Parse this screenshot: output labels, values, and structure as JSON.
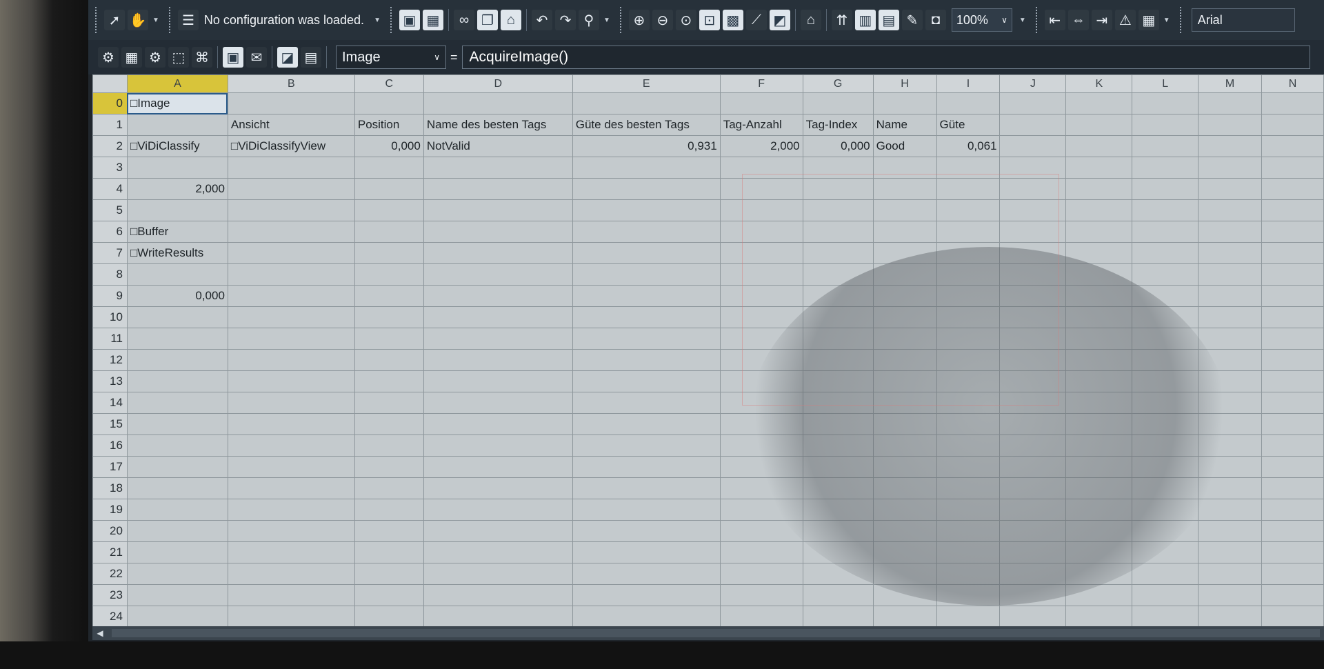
{
  "toolbar_top": {
    "status_message": "No configuration was loaded.",
    "zoom_value": "100%",
    "font_name": "Arial",
    "icons": [
      "pointer-icon",
      "hand-icon",
      "list-icon",
      "image-icon",
      "image-edit-icon",
      "binoculars-icon",
      "copy-icon",
      "paste-icon",
      "undo-icon",
      "redo-icon",
      "find-icon",
      "zoom-in-icon",
      "zoom-out-icon",
      "zoom-fit-icon",
      "zoom-select-icon",
      "grid-icon",
      "chart-icon",
      "image-view-icon",
      "house-icon",
      "insert-row-icon",
      "insert-column-icon",
      "table-icon",
      "pen-icon",
      "camera-icon",
      "align-left-icon",
      "align-center-icon",
      "align-right-icon",
      "warning-icon",
      "format-icon"
    ]
  },
  "toolbar_formula": {
    "name_box": "Image",
    "equals": "=",
    "formula": "AcquireImage()",
    "icons": [
      "toolbox-icon",
      "table-insert-icon",
      "gears-icon",
      "select-icon",
      "network-icon",
      "display-icon",
      "comment-icon",
      "image-window-icon",
      "results-icon"
    ]
  },
  "grid": {
    "columns": [
      "A",
      "B",
      "C",
      "D",
      "E",
      "F",
      "G",
      "H",
      "I",
      "J",
      "K",
      "L",
      "M",
      "N"
    ],
    "selected_column": "A",
    "rows": [
      {
        "num": "0",
        "cells": [
          "□Image",
          "",
          "",
          "",
          "",
          "",
          "",
          "",
          "",
          "",
          "",
          "",
          "",
          ""
        ]
      },
      {
        "num": "1",
        "cells": [
          "",
          "Ansicht",
          "Position",
          "Name des besten Tags",
          "Güte des besten Tags",
          "Tag-Anzahl",
          "Tag-Index",
          "Name",
          "Güte",
          "",
          "",
          "",
          "",
          ""
        ]
      },
      {
        "num": "2",
        "cells": [
          "□ViDiClassify",
          "□ViDiClassifyView",
          "0,000",
          "NotValid",
          "0,931",
          "2,000",
          "0,000",
          "Good",
          "0,061",
          "",
          "",
          "",
          "",
          ""
        ]
      },
      {
        "num": "3",
        "cells": [
          "",
          "",
          "",
          "",
          "",
          "",
          "",
          "",
          "",
          "",
          "",
          "",
          "",
          ""
        ]
      },
      {
        "num": "4",
        "cells": [
          "2,000",
          "",
          "",
          "",
          "",
          "",
          "",
          "",
          "",
          "",
          "",
          "",
          "",
          ""
        ]
      },
      {
        "num": "5",
        "cells": [
          "",
          "",
          "",
          "",
          "",
          "",
          "",
          "",
          "",
          "",
          "",
          "",
          "",
          ""
        ]
      },
      {
        "num": "6",
        "cells": [
          "□Buffer",
          "",
          "",
          "",
          "",
          "",
          "",
          "",
          "",
          "",
          "",
          "",
          "",
          ""
        ]
      },
      {
        "num": "7",
        "cells": [
          "□WriteResults",
          "",
          "",
          "",
          "",
          "",
          "",
          "",
          "",
          "",
          "",
          "",
          "",
          ""
        ]
      },
      {
        "num": "8",
        "cells": [
          "",
          "",
          "",
          "",
          "",
          "",
          "",
          "",
          "",
          "",
          "",
          "",
          "",
          ""
        ]
      },
      {
        "num": "9",
        "cells": [
          "0,000",
          "",
          "",
          "",
          "",
          "",
          "",
          "",
          "",
          "",
          "",
          "",
          "",
          ""
        ]
      },
      {
        "num": "10",
        "cells": [
          "",
          "",
          "",
          "",
          "",
          "",
          "",
          "",
          "",
          "",
          "",
          "",
          "",
          ""
        ]
      },
      {
        "num": "11",
        "cells": [
          "",
          "",
          "",
          "",
          "",
          "",
          "",
          "",
          "",
          "",
          "",
          "",
          "",
          ""
        ]
      },
      {
        "num": "12",
        "cells": [
          "",
          "",
          "",
          "",
          "",
          "",
          "",
          "",
          "",
          "",
          "",
          "",
          "",
          ""
        ]
      },
      {
        "num": "13",
        "cells": [
          "",
          "",
          "",
          "",
          "",
          "",
          "",
          "",
          "",
          "",
          "",
          "",
          "",
          ""
        ]
      },
      {
        "num": "14",
        "cells": [
          "",
          "",
          "",
          "",
          "",
          "",
          "",
          "",
          "",
          "",
          "",
          "",
          "",
          ""
        ]
      },
      {
        "num": "15",
        "cells": [
          "",
          "",
          "",
          "",
          "",
          "",
          "",
          "",
          "",
          "",
          "",
          "",
          "",
          ""
        ]
      },
      {
        "num": "16",
        "cells": [
          "",
          "",
          "",
          "",
          "",
          "",
          "",
          "",
          "",
          "",
          "",
          "",
          "",
          ""
        ]
      },
      {
        "num": "17",
        "cells": [
          "",
          "",
          "",
          "",
          "",
          "",
          "",
          "",
          "",
          "",
          "",
          "",
          "",
          ""
        ]
      },
      {
        "num": "18",
        "cells": [
          "",
          "",
          "",
          "",
          "",
          "",
          "",
          "",
          "",
          "",
          "",
          "",
          "",
          ""
        ]
      },
      {
        "num": "19",
        "cells": [
          "",
          "",
          "",
          "",
          "",
          "",
          "",
          "",
          "",
          "",
          "",
          "",
          "",
          ""
        ]
      },
      {
        "num": "20",
        "cells": [
          "",
          "",
          "",
          "",
          "",
          "",
          "",
          "",
          "",
          "",
          "",
          "",
          "",
          ""
        ]
      },
      {
        "num": "21",
        "cells": [
          "",
          "",
          "",
          "",
          "",
          "",
          "",
          "",
          "",
          "",
          "",
          "",
          "",
          ""
        ]
      },
      {
        "num": "22",
        "cells": [
          "",
          "",
          "",
          "",
          "",
          "",
          "",
          "",
          "",
          "",
          "",
          "",
          "",
          ""
        ]
      },
      {
        "num": "23",
        "cells": [
          "",
          "",
          "",
          "",
          "",
          "",
          "",
          "",
          "",
          "",
          "",
          "",
          "",
          ""
        ]
      },
      {
        "num": "24",
        "cells": [
          "",
          "",
          "",
          "",
          "",
          "",
          "",
          "",
          "",
          "",
          "",
          "",
          "",
          ""
        ]
      }
    ],
    "numeric_cells": [
      "2-2",
      "2-4",
      "2-5",
      "2-6",
      "2-8",
      "4-0",
      "9-0"
    ]
  },
  "colors": {
    "toolbar_bg": "#27313a",
    "grid_bg": "#c4cacd",
    "selected_header": "#d8c43a"
  }
}
